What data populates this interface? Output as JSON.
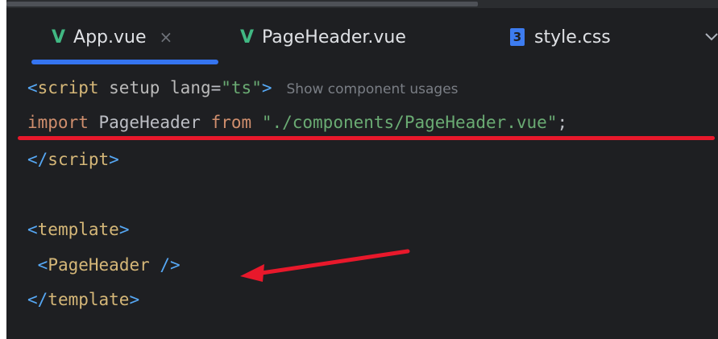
{
  "tabs": [
    {
      "label": "App.vue",
      "icon": "vue-icon",
      "active": true,
      "close": "×"
    },
    {
      "label": "PageHeader.vue",
      "icon": "vue-icon",
      "active": false
    },
    {
      "label": "style.css",
      "icon": "css-icon",
      "active": false
    }
  ],
  "tab_overflow_icon": "chevron-down-icon",
  "code": {
    "line1": {
      "open": "<",
      "tag": "script",
      "attr1": " setup ",
      "attr2": "lang",
      "eq": "=",
      "value": "\"ts\"",
      "close": ">",
      "hint": "Show component usages"
    },
    "line2": {
      "kw1": "import",
      "name": " PageHeader ",
      "kw2": "from",
      "space": " ",
      "path": "\"./components/PageHeader.vue\"",
      "semi": ";"
    },
    "line3": {
      "open": "</",
      "tag": "script",
      "close": ">"
    },
    "line5": {
      "open": "<",
      "tag": "template",
      "close": ">"
    },
    "line6": {
      "indent": " ",
      "open": "<",
      "tag": "PageHeader",
      "close": " />"
    },
    "line7": {
      "open": "</",
      "tag": "template",
      "close": ">"
    }
  },
  "colors": {
    "background": "#1e1f22",
    "vue_green": "#41b883",
    "css_blue": "#3d7cf0",
    "annotation_red": "#e8182b",
    "active_tab_underline": "#3574f0"
  },
  "annotations": [
    "red-underline",
    "red-arrow"
  ]
}
